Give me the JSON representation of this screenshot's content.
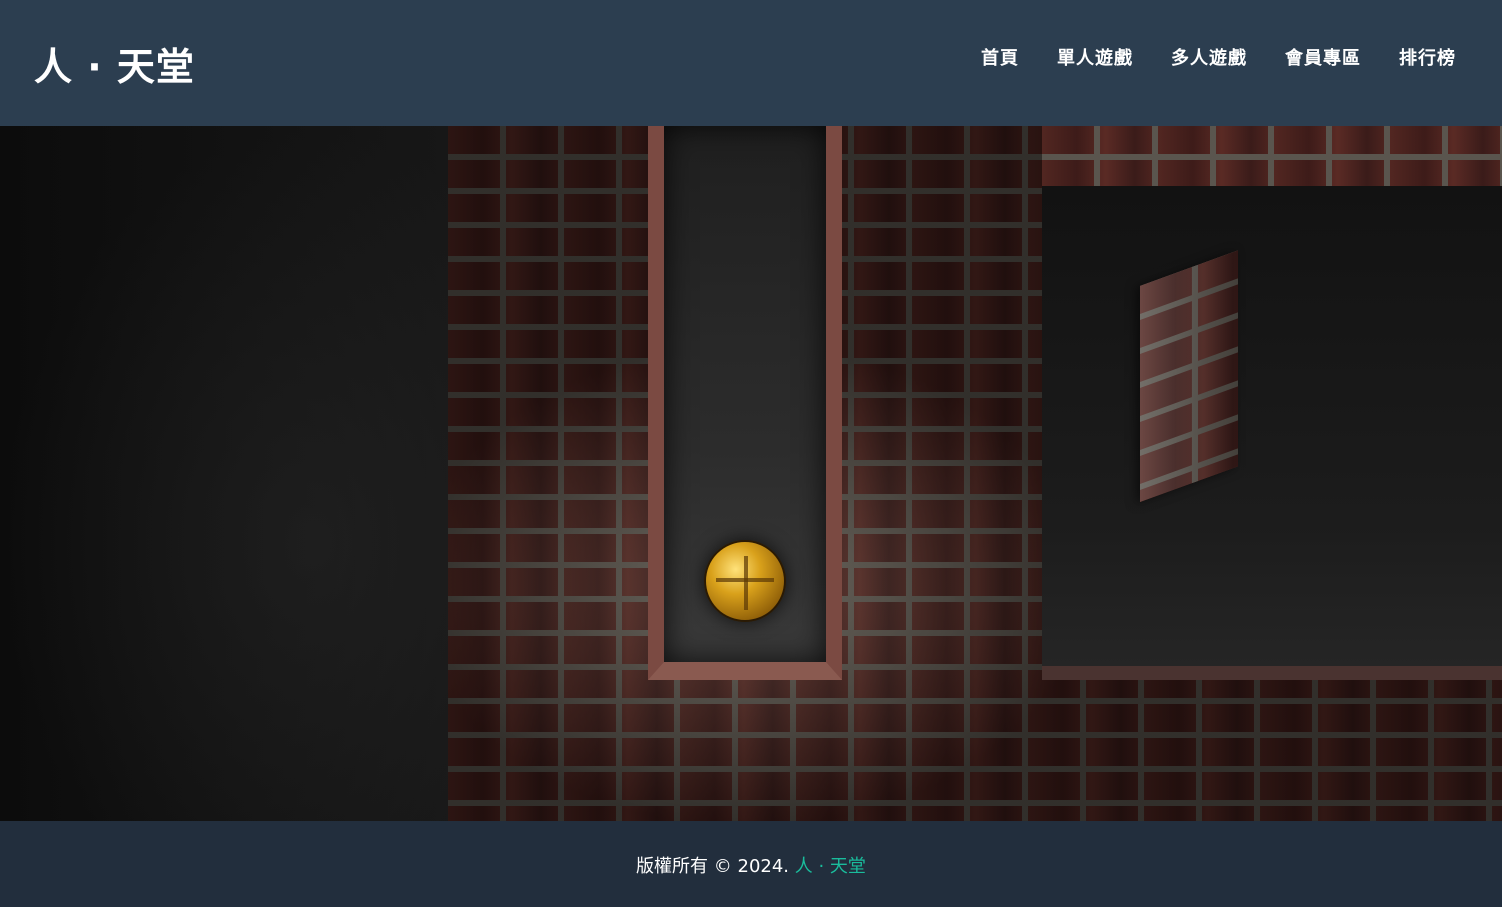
{
  "header": {
    "logo": "人 · 天堂",
    "nav": [
      {
        "label": "首頁"
      },
      {
        "label": "單人遊戲"
      },
      {
        "label": "多人遊戲"
      },
      {
        "label": "會員專區"
      },
      {
        "label": "排行榜"
      }
    ]
  },
  "game": {
    "type": "3d-maze-ball",
    "accent_color": "#d9a11b",
    "wall_texture": "red-brick",
    "floor_texture": "dark-concrete"
  },
  "footer": {
    "copyright": "版權所有 © 2024.",
    "site_link": "人 · 天堂"
  },
  "colors": {
    "header_bg": "#2c3e50",
    "footer_bg": "#222e3d",
    "link_accent": "#1abc9c"
  }
}
